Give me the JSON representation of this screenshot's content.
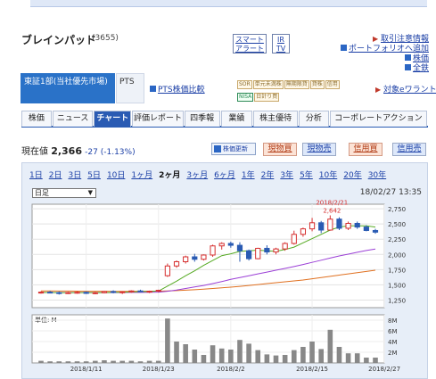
{
  "stock": {
    "name": "ブレインパッド",
    "code": "(3655)"
  },
  "buttons": {
    "smart_alert": "スマート\nアラート",
    "ir_tv": "IR\nTV"
  },
  "side_links": {
    "regulation": "取引注意情報",
    "portfolio_add": "ポートフォリオへ追加",
    "stock": "株価",
    "all": "全鉄"
  },
  "market": {
    "label": "東証1部(当社優先市場)",
    "pts": "PTS",
    "pts_compare": "PTS株価比較"
  },
  "badges": [
    "SOR",
    "単元未満株",
    "無期限貸",
    "貸株",
    "信用",
    "NISA",
    "日計り買"
  ],
  "to_ewarrant": "対象eワラント",
  "tabs": [
    "株価",
    "ニュース",
    "チャート",
    "評価レポート",
    "四季報",
    "業績",
    "株主優待",
    "分析",
    "コーポレートアクション"
  ],
  "active_tab": 2,
  "price": {
    "label": "現在値",
    "value": "2,366",
    "change": "-27 (-1.13%)",
    "refresh": "株価更新"
  },
  "trade_buttons": [
    "現物買",
    "現物売",
    "信用買",
    "信用売"
  ],
  "periods": [
    "1日",
    "2日",
    "3日",
    "5日",
    "10日",
    "1ヶ月",
    "2ヶ月",
    "3ヶ月",
    "6ヶ月",
    "1年",
    "2年",
    "3年",
    "5年",
    "10年",
    "20年",
    "30年"
  ],
  "current_period": "2ヶ月",
  "chart_select": "日足",
  "timestamp": "18/02/27 13:35",
  "colors": {
    "accent": "#2a5bb3",
    "up": "#d62f2f",
    "down": "#2a5bb3",
    "ma5": "#55aa22",
    "ma25": "#9b3fd6",
    "ma75": "#e07020",
    "volume": "#888888"
  },
  "chart_data": {
    "type": "candlestick",
    "ylabel_unit": "",
    "yticks": [
      1250,
      1500,
      1750,
      2000,
      2250,
      2500,
      2750
    ],
    "ylim": [
      1125,
      2825
    ],
    "annotation": {
      "date": "2018/2/21",
      "value": "2,642"
    },
    "x_labels": [
      "2018/1/11",
      "2018/1/23",
      "2018/2/2",
      "2018/2/15",
      "2018/2/27"
    ],
    "x_label_index": [
      5,
      13,
      21,
      30,
      38
    ],
    "candles": [
      [
        1370,
        1395,
        1355,
        1380
      ],
      [
        1380,
        1400,
        1360,
        1372
      ],
      [
        1372,
        1390,
        1340,
        1368
      ],
      [
        1368,
        1385,
        1350,
        1372
      ],
      [
        1372,
        1395,
        1355,
        1378
      ],
      [
        1378,
        1390,
        1350,
        1360
      ],
      [
        1360,
        1385,
        1345,
        1370
      ],
      [
        1370,
        1400,
        1360,
        1390
      ],
      [
        1390,
        1410,
        1360,
        1375
      ],
      [
        1375,
        1395,
        1350,
        1385
      ],
      [
        1385,
        1410,
        1370,
        1400
      ],
      [
        1400,
        1420,
        1380,
        1390
      ],
      [
        1390,
        1405,
        1365,
        1395
      ],
      [
        1395,
        1420,
        1380,
        1410
      ],
      [
        1650,
        1850,
        1630,
        1810
      ],
      [
        1810,
        1900,
        1780,
        1880
      ],
      [
        1880,
        1980,
        1850,
        1960
      ],
      [
        1960,
        2010,
        1880,
        1920
      ],
      [
        1920,
        2000,
        1900,
        1990
      ],
      [
        1990,
        2160,
        1960,
        2140
      ],
      [
        2140,
        2200,
        2080,
        2180
      ],
      [
        2180,
        2210,
        2110,
        2150
      ],
      [
        2150,
        2200,
        1880,
        2060
      ],
      [
        2060,
        2080,
        1900,
        1930
      ],
      [
        1930,
        2110,
        1920,
        2100
      ],
      [
        2100,
        2150,
        2000,
        2040
      ],
      [
        2040,
        2110,
        2000,
        2090
      ],
      [
        2090,
        2200,
        2060,
        2180
      ],
      [
        2180,
        2390,
        2160,
        2330
      ],
      [
        2330,
        2440,
        2290,
        2420
      ],
      [
        2420,
        2600,
        2380,
        2520
      ],
      [
        2520,
        2550,
        2350,
        2400
      ],
      [
        2400,
        2642,
        2390,
        2580
      ],
      [
        2580,
        2610,
        2400,
        2430
      ],
      [
        2430,
        2540,
        2400,
        2510
      ],
      [
        2510,
        2540,
        2420,
        2450
      ],
      [
        2450,
        2480,
        2380,
        2393
      ],
      [
        2393,
        2420,
        2340,
        2366
      ]
    ],
    "ma5": [
      1375,
      1374,
      1372,
      1371,
      1373,
      1372,
      1372,
      1373,
      1375,
      1378,
      1383,
      1388,
      1392,
      1398,
      1480,
      1560,
      1650,
      1730,
      1820,
      1900,
      1980,
      2010,
      2050,
      2060,
      2070,
      2060,
      2050,
      2080,
      2120,
      2190,
      2260,
      2330,
      2400,
      2450,
      2470,
      2470,
      2470,
      2450
    ],
    "ma25": [
      1375,
      1374,
      1373,
      1372,
      1372,
      1372,
      1372,
      1372,
      1373,
      1374,
      1375,
      1376,
      1378,
      1380,
      1395,
      1415,
      1440,
      1465,
      1490,
      1520,
      1555,
      1590,
      1620,
      1650,
      1680,
      1710,
      1740,
      1770,
      1800,
      1835,
      1870,
      1905,
      1940,
      1975,
      2005,
      2035,
      2065,
      2090
    ],
    "ma75": [
      1400,
      1399,
      1398,
      1397,
      1396,
      1395,
      1394,
      1394,
      1393,
      1393,
      1393,
      1394,
      1395,
      1396,
      1400,
      1405,
      1412,
      1420,
      1430,
      1440,
      1450,
      1462,
      1475,
      1490,
      1505,
      1520,
      1535,
      1550,
      1565,
      1580,
      1600,
      1620,
      1640,
      1660,
      1680,
      1700,
      1720,
      1740
    ],
    "volume_unit": "単位: M",
    "volume_ticks": [
      "2M",
      "4M",
      "6M",
      "8M"
    ],
    "volume_max": 9,
    "volume": [
      0.4,
      0.3,
      0.3,
      0.3,
      0.3,
      0.3,
      0.4,
      0.5,
      0.4,
      0.4,
      0.4,
      0.3,
      0.4,
      0.4,
      8.3,
      4.0,
      3.5,
      2.5,
      1.5,
      3.3,
      2.7,
      2.5,
      4.3,
      3.6,
      2.4,
      1.6,
      1.4,
      1.5,
      2.4,
      3.0,
      4.0,
      2.6,
      6.2,
      3.0,
      1.8,
      1.8,
      1.0,
      1.0
    ]
  }
}
